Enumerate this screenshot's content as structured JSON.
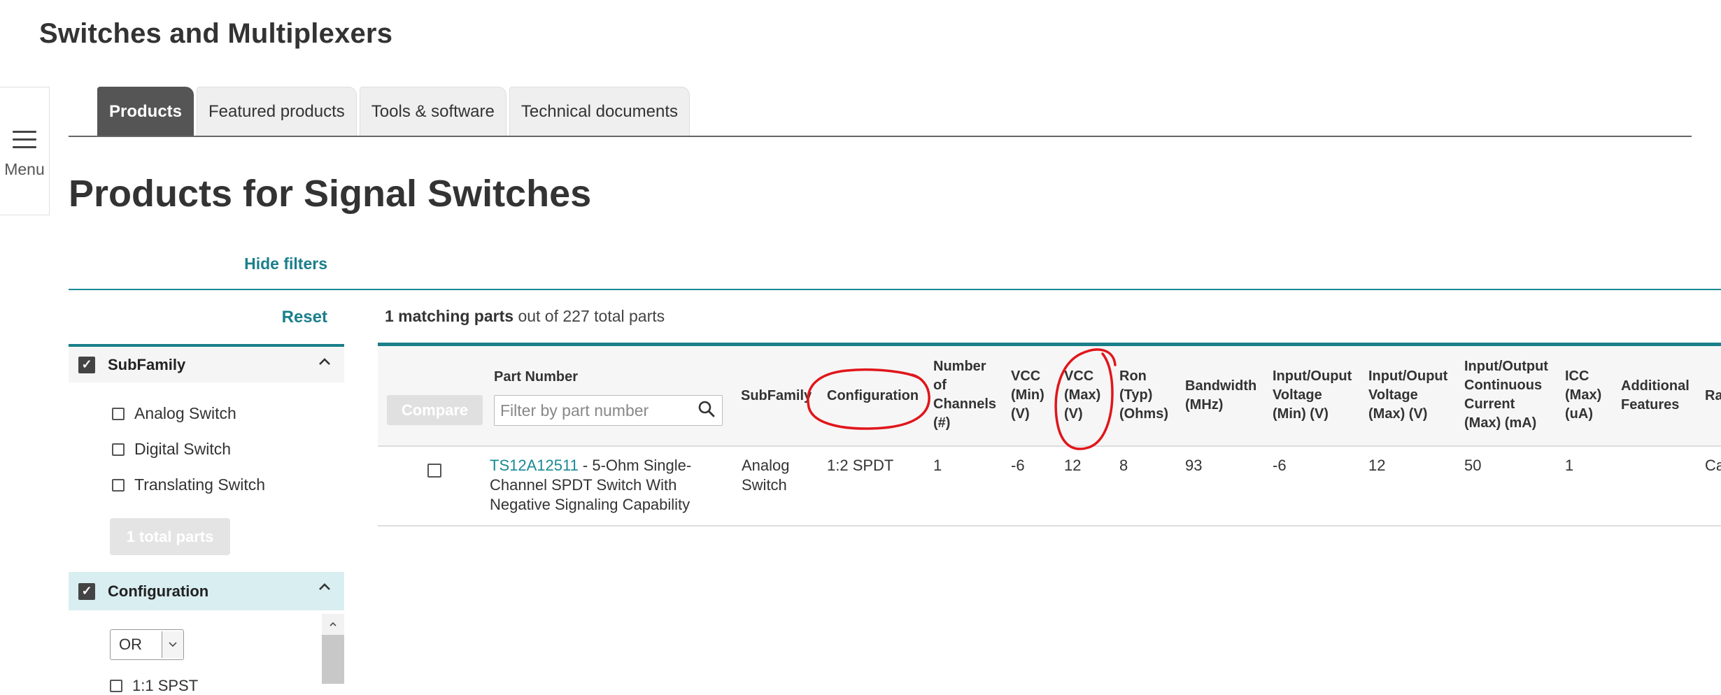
{
  "site": {
    "title": "Switches and Multiplexers"
  },
  "menu": {
    "label": "Menu"
  },
  "tabs": [
    {
      "label": "Products",
      "active": true
    },
    {
      "label": "Featured products"
    },
    {
      "label": "Tools & software"
    },
    {
      "label": "Technical documents"
    }
  ],
  "page": {
    "title": "Products for Signal Switches"
  },
  "filters": {
    "hide_label": "Hide filters",
    "reset_label": "Reset",
    "subfamily": {
      "title": "SubFamily",
      "options": [
        "Analog Switch",
        "Digital Switch",
        "Translating Switch"
      ],
      "total_button": "1 total parts"
    },
    "configuration": {
      "title": "Configuration",
      "logic_value": "OR",
      "partial_option": "1:1 SPST"
    }
  },
  "results": {
    "match_count": "1 matching parts",
    "total_text": "out of 227 total parts",
    "compare_label": "Compare",
    "filter_placeholder": "Filter by part number",
    "columns": {
      "part_number": "Part Number",
      "subfamily": "SubFamily",
      "configuration": "Configuration",
      "channels": [
        "Number",
        "of",
        "Channels",
        "(#)"
      ],
      "vcc_min": [
        "VCC",
        "(Min)",
        "(V)"
      ],
      "vcc_max": [
        "VCC",
        "(Max)",
        "(V)"
      ],
      "ron": [
        "Ron",
        "(Typ)",
        "(Ohms)"
      ],
      "bandwidth": [
        "Bandwidth",
        "(MHz)"
      ],
      "io_vmin": [
        "Input/Ouput",
        "Voltage",
        "(Min) (V)"
      ],
      "io_vmax": [
        "Input/Ouput",
        "Voltage",
        "(Max) (V)"
      ],
      "io_current": [
        "Input/Output",
        "Continuous",
        "Current",
        "(Max) (mA)"
      ],
      "icc": [
        "ICC",
        "(Max)",
        "(uA)"
      ],
      "features": [
        "Additional",
        "Features"
      ],
      "rating_cut": "Ra"
    },
    "row": {
      "part_number": "TS12A12511",
      "description_lines": [
        " - 5-Ohm Single-",
        "Channel SPDT Switch With",
        "Negative Signaling Capability"
      ],
      "subfamily_lines": [
        "Analog",
        "Switch"
      ],
      "configuration": "1:2 SPDT",
      "channels": "1",
      "vcc_min": "-6",
      "vcc_max": "12",
      "ron": "8",
      "bandwidth": "93",
      "io_vmin": "-6",
      "io_vmax": "12",
      "io_current": "50",
      "icc": "1",
      "features": "",
      "rating_cut": "Ca"
    }
  },
  "colors": {
    "accent": "#1a7f8a",
    "annotation": "#e0161b",
    "active_tab": "#555555"
  },
  "icons": {
    "menu": "hamburger-icon",
    "search": "search-icon",
    "check": "checkmark-icon",
    "collapse": "chevron-up-icon",
    "dropdown": "chevron-down-icon"
  }
}
